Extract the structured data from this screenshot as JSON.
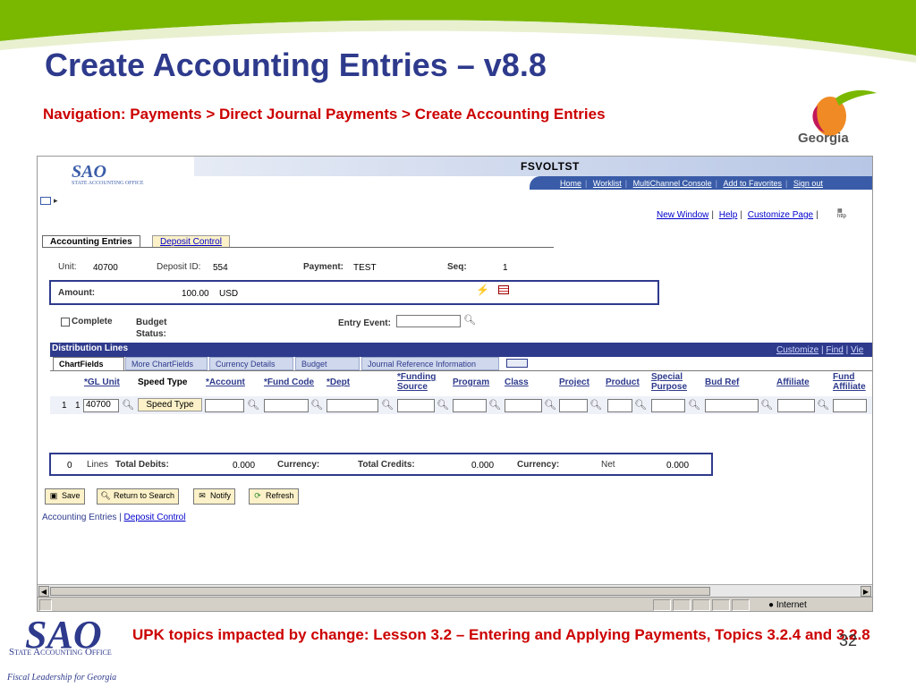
{
  "slide": {
    "title": "Create Accounting Entries – v8.8",
    "navigation": "Navigation: Payments > Direct Journal Payments > Create Accounting Entries",
    "georgia_logo": "Georgia",
    "upk_text": "UPK topics impacted by change: Lesson 3.2 – Entering and Applying Payments, Topics 3.2.4 and 3.2.8",
    "page_number": "32",
    "sao_logo": "SAO",
    "sao_office": "State Accounting Office",
    "sao_tagline": "Fiscal Leadership for Georgia"
  },
  "app": {
    "logo": "SAO",
    "logo_sub": "STATE ACCOUNTING OFFICE",
    "environment": "FSVOLTST",
    "header_links": [
      "Home",
      "Worklist",
      "MultiChannel Console",
      "Add to Favorites",
      "Sign out"
    ],
    "page_links": [
      "New Window",
      "Help",
      "Customize Page"
    ],
    "http_icon": "http"
  },
  "tabs": {
    "active": "Accounting Entries",
    "inactive": "Deposit Control"
  },
  "form": {
    "unit_label": "Unit:",
    "unit_value": "40700",
    "deposit_id_label": "Deposit ID:",
    "deposit_id_value": "554",
    "payment_label": "Payment:",
    "payment_value": "TEST",
    "seq_label": "Seq:",
    "seq_value": "1",
    "amount_label": "Amount:",
    "amount_value": "100.00",
    "amount_currency": "USD",
    "complete_label": "Complete",
    "complete_checked": false,
    "budget_status_label": "Budget Status:",
    "entry_event_label": "Entry Event:",
    "entry_event_value": ""
  },
  "distribution": {
    "title": "Distribution Lines",
    "links": [
      "Customize",
      "Find",
      "Vie"
    ],
    "subtabs": [
      "ChartFields",
      "More ChartFields",
      "Currency Details",
      "Budget",
      "Journal Reference Information"
    ],
    "columns": {
      "gl_unit": "*GL Unit",
      "speed_type": "Speed Type",
      "account": "*Account",
      "fund_code": "*Fund Code",
      "dept": "*Dept",
      "funding_source": "*Funding Source",
      "program": "Program",
      "class": "Class",
      "project": "Project",
      "product": "Product",
      "special_purpose": "Special Purpose",
      "bud_ref": "Bud Ref",
      "affiliate": "Affiliate",
      "fund_affiliate": "Fund Affiliate"
    },
    "row": {
      "line": "1",
      "seq": "1",
      "gl_unit": "40700",
      "speed_type_button": "Speed Type"
    }
  },
  "totals": {
    "lines_count": "0",
    "lines_label": "Lines",
    "total_debits_label": "Total Debits:",
    "total_debits_value": "0.000",
    "currency_label_1": "Currency:",
    "total_credits_label": "Total Credits:",
    "total_credits_value": "0.000",
    "currency_label_2": "Currency:",
    "net_label": "Net",
    "net_value": "0.000"
  },
  "buttons": {
    "save": "Save",
    "return_to_search": "Return to Search",
    "notify": "Notify",
    "refresh": "Refresh"
  },
  "bottom_links": [
    "Accounting Entries",
    "Deposit Control"
  ],
  "statusbar": {
    "zone": "Internet"
  },
  "colors": {
    "title_blue": "#2e3a8c",
    "nav_red": "#cc0000",
    "ps_blue": "#3a5ca8",
    "tab_yellow": "#fcf1c8",
    "green_swoosh": "#7ab800"
  }
}
